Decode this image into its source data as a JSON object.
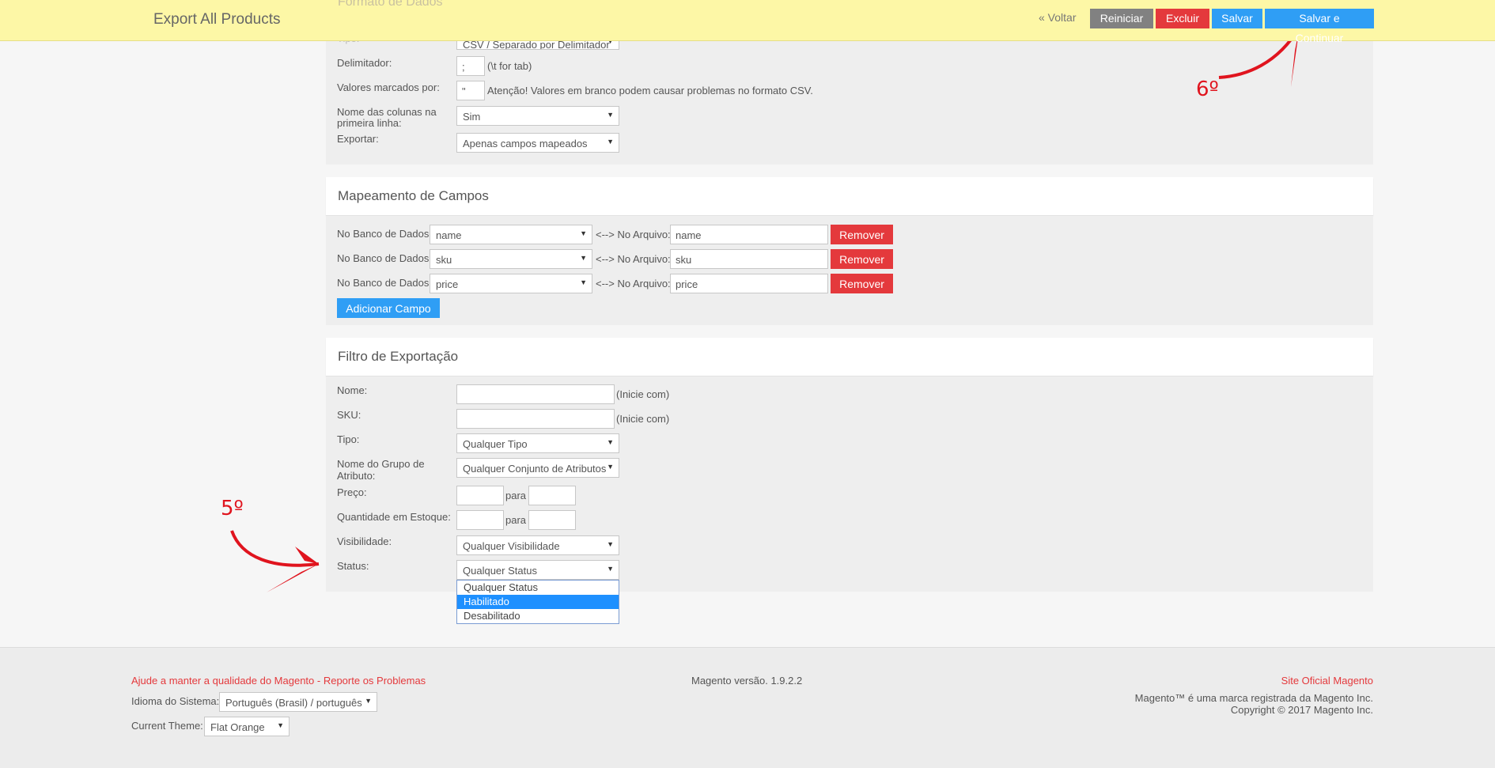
{
  "header": {
    "faded_title": "Formato de Dados",
    "title": "Export All Products",
    "back": "« Voltar",
    "btn_reset": "Reiniciar",
    "btn_delete": "Excluir",
    "btn_save": "Salvar",
    "btn_save_continue": "Salvar e Continuar"
  },
  "format": {
    "tipo_label": "Tipo:",
    "tipo_value": "CSV / Separado por Delimitador",
    "delim_label": "Delimitador:",
    "delim_value": ";",
    "delim_note": "(\\t for tab)",
    "enclose_label": "Valores marcados por:",
    "enclose_value": "\"",
    "enclose_note": "Atenção! Valores em branco podem causar problemas no formato CSV.",
    "colnames_label_1": "Nome das colunas na",
    "colnames_label_2": "primeira linha:",
    "colnames_value": "Sim",
    "export_label": "Exportar:",
    "export_value": "Apenas campos mapeados"
  },
  "mapping": {
    "title": "Mapeamento de Campos",
    "db_label": "No Banco de Dados:",
    "file_label": "<--> No Arquivo:",
    "remove": "Remover",
    "add": "Adicionar Campo",
    "rows": [
      {
        "db": "name",
        "file": "name"
      },
      {
        "db": "sku",
        "file": "sku"
      },
      {
        "db": "price",
        "file": "price"
      }
    ]
  },
  "filter": {
    "title": "Filtro de Exportação",
    "nome_label": "Nome:",
    "nome_note": "(Inicie com)",
    "sku_label": "SKU:",
    "sku_note": "(Inicie com)",
    "tipo_label": "Tipo:",
    "tipo_value": "Qualquer Tipo",
    "attr_label_1": "Nome do Grupo de",
    "attr_label_2": "Atributo:",
    "attr_value": "Qualquer Conjunto de Atributos",
    "preco_label": "Preço:",
    "para": "para",
    "qty_label": "Quantidade em Estoque:",
    "vis_label": "Visibilidade:",
    "vis_value": "Qualquer Visibilidade",
    "status_label": "Status:",
    "status_value": "Qualquer Status",
    "status_options": [
      "Qualquer Status",
      "Habilitado",
      "Desabilitado"
    ]
  },
  "annotations": {
    "step5": "5º",
    "step6": "6º"
  },
  "footer": {
    "help_link": "Ajude a manter a qualidade do Magento - Reporte os Problemas",
    "lang_label": "Idioma do Sistema:",
    "lang_value": "Português (Brasil) / português",
    "theme_label": "Current Theme:",
    "theme_value": "Flat Orange",
    "version": "Magento versão. 1.9.2.2",
    "official_link": "Site Oficial Magento",
    "trademark": "Magento™ é uma marca registrada da Magento Inc.",
    "copyright": "Copyright © 2017 Magento Inc."
  },
  "colors": {
    "header_bg": "#fdf7a6",
    "blue": "#2f9ef5",
    "red": "#e4393c",
    "annotation": "#e0141e"
  }
}
